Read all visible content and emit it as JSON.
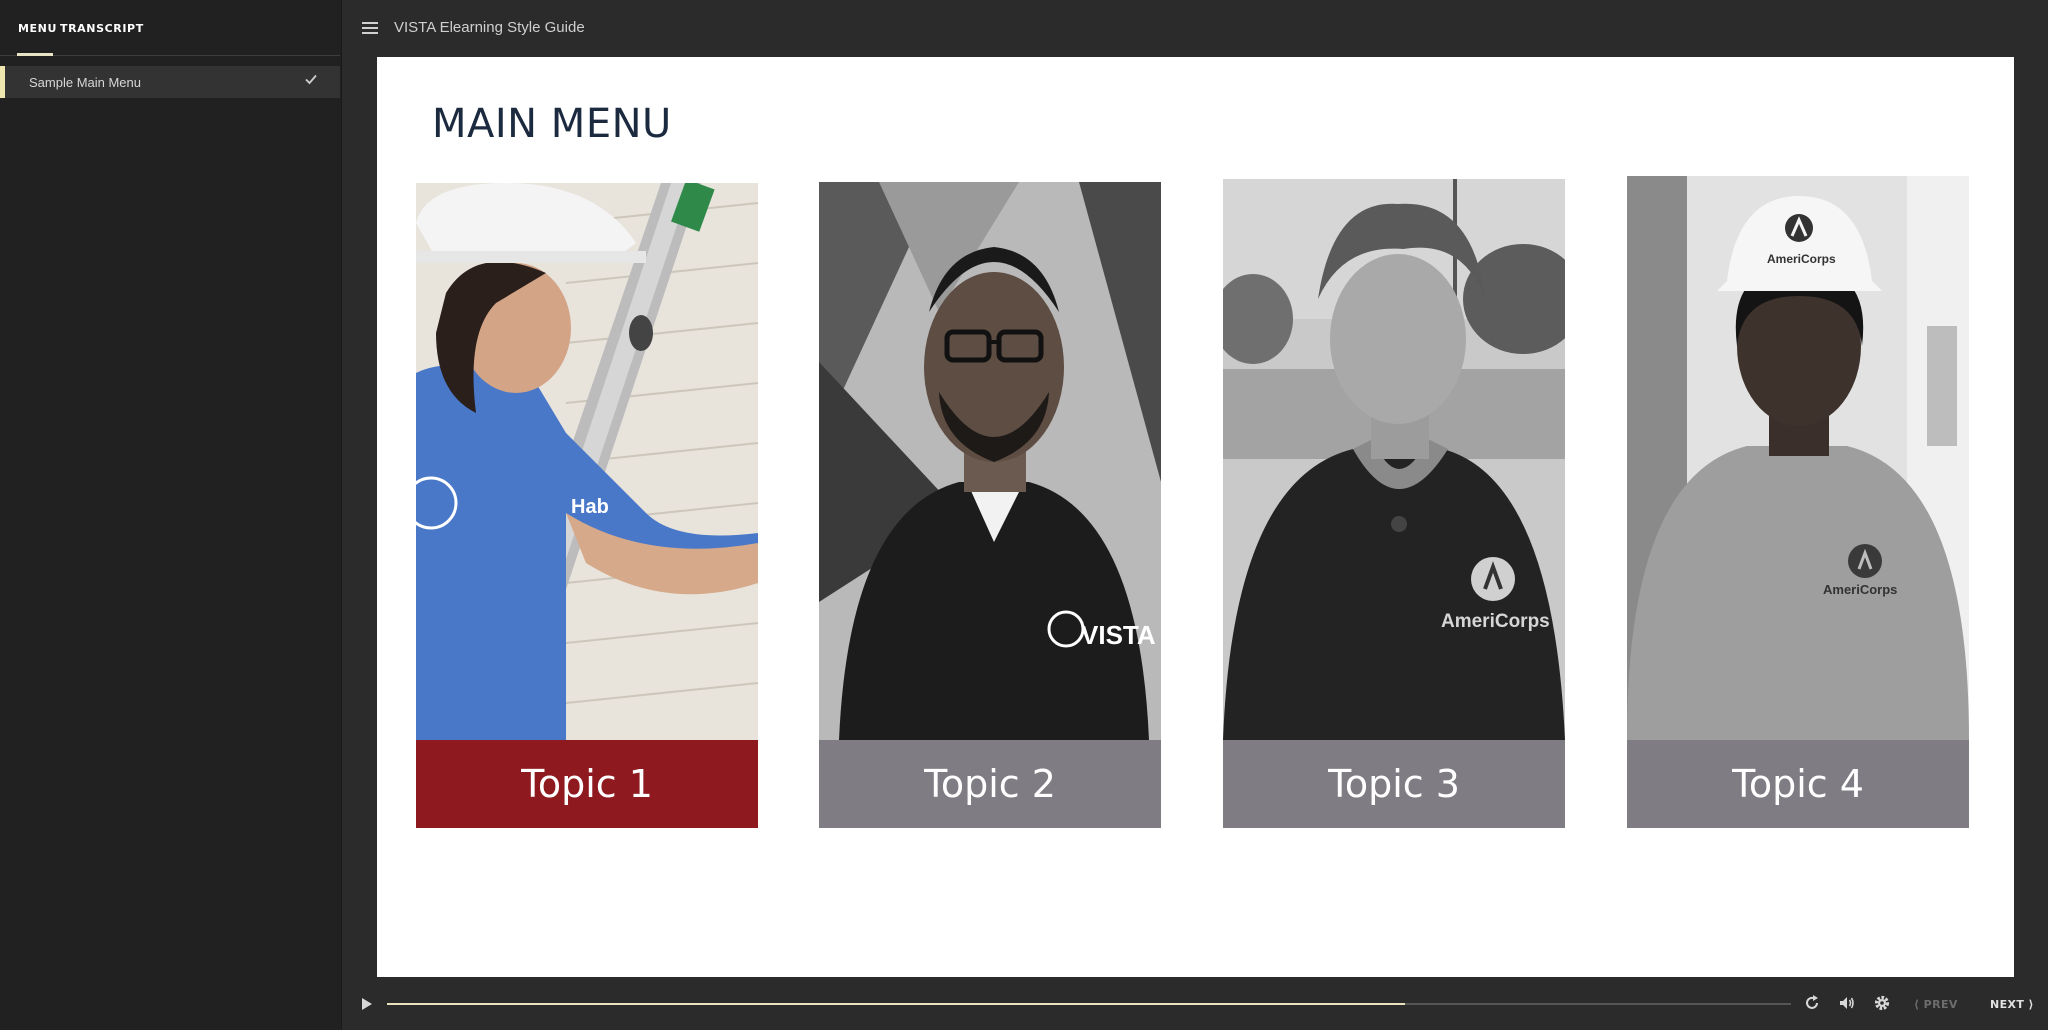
{
  "sidebar": {
    "tabs": [
      {
        "label": "MENU"
      },
      {
        "label": "TRANSCRIPT"
      }
    ],
    "items": [
      {
        "label": "Sample Main Menu",
        "check_icon": "check-icon",
        "completed": true
      }
    ]
  },
  "topbar": {
    "menu_icon": "hamburger-icon",
    "title": "VISTA Elearning Style Guide"
  },
  "slide": {
    "title": "MAIN MENU",
    "cards": [
      {
        "label": "Topic 1",
        "label_color": "#8e1a1f",
        "photo": "volunteer in blue t-shirt and hard hat on ladder"
      },
      {
        "label": "Topic 2",
        "label_color": "#7f7d83",
        "photo": "man with glasses in VISTA polo, black and white"
      },
      {
        "label": "Topic 3",
        "label_color": "#7f7d83",
        "photo": "woman in AmeriCorps polo, black and white"
      },
      {
        "label": "Topic 4",
        "label_color": "#7f7d83",
        "photo": "young man in AmeriCorps hard hat and t-shirt, black and white"
      }
    ]
  },
  "controls": {
    "play_icon": "play-icon",
    "progress": 0.725,
    "replay_icon": "replay-icon",
    "volume_icon": "volume-icon",
    "settings_icon": "gear-icon",
    "prev_label": "PREV",
    "next_label": "NEXT"
  },
  "colors": {
    "accent": "#e9e2bd",
    "sidebar_bg": "#212121",
    "topic_active": "#8e1a1f",
    "topic_inactive": "#7f7d83",
    "title_color": "#1c2a3f"
  }
}
